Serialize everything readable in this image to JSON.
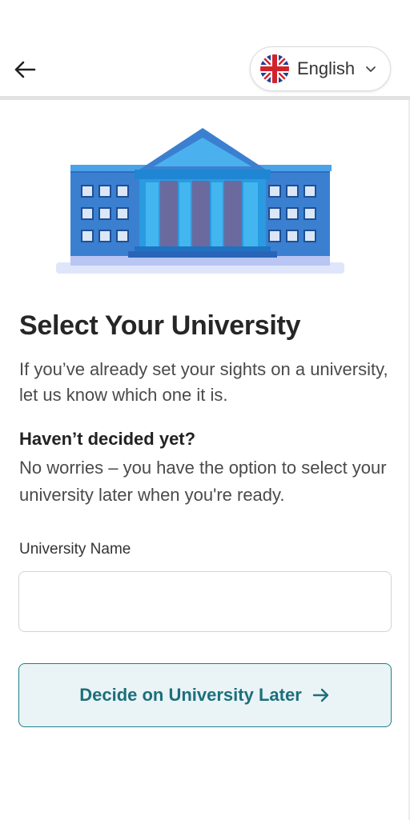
{
  "header": {
    "language_label": "English"
  },
  "content": {
    "title": "Select Your University",
    "description": "If you’ve already set your sights on a university, let us know which one it is.",
    "subheading": "Haven’t decided yet?",
    "subdescription": "No worries – you have the option to select your university later when you're ready."
  },
  "form": {
    "university_label": "University Name",
    "university_value": "",
    "university_placeholder": ""
  },
  "actions": {
    "decide_later_label": "Decide on University Later"
  },
  "icons": {
    "back": "arrow-left-icon",
    "flag": "uk-flag-icon",
    "chevron": "chevron-down-icon",
    "illustration": "university-building-icon",
    "button_arrow": "arrow-right-icon"
  },
  "colors": {
    "accent": "#1d6f7c",
    "button_bg": "#eaf4f6",
    "building_blue": "#2f80d8"
  }
}
